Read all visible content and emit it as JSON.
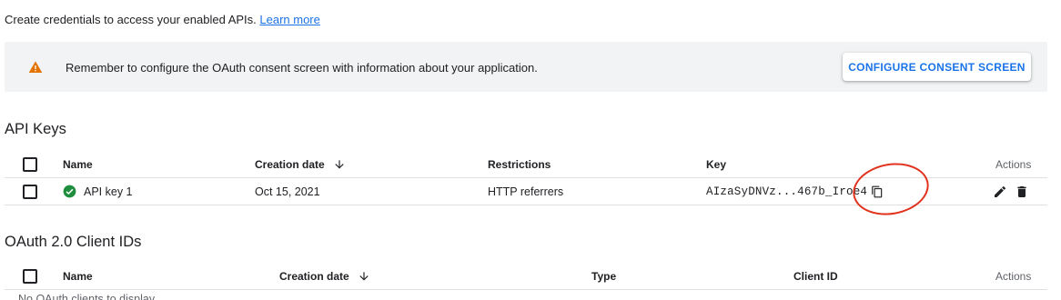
{
  "intro": {
    "text": "Create credentials to access your enabled APIs.",
    "link": "Learn more"
  },
  "banner": {
    "icon": "warning-icon",
    "message": "Remember to configure the OAuth consent screen with information about your application.",
    "button": "CONFIGURE CONSENT SCREEN"
  },
  "api_keys": {
    "title": "API Keys",
    "columns": {
      "name": "Name",
      "creation_date": "Creation date",
      "restrictions": "Restrictions",
      "key": "Key",
      "actions": "Actions"
    },
    "rows": [
      {
        "name": "API key 1",
        "created": "Oct 15, 2021",
        "restrictions": "HTTP referrers",
        "key": "AIzaSyDNVz...467b_Iroe4"
      }
    ]
  },
  "oauth": {
    "title": "OAuth 2.0 Client IDs",
    "columns": {
      "name": "Name",
      "creation_date": "Creation date",
      "type": "Type",
      "client_id": "Client ID",
      "actions": "Actions"
    },
    "empty_text": "No OAuth clients to display"
  },
  "colors": {
    "accent": "#1a73e8",
    "warning": "#e37400",
    "success": "#1e8e3e",
    "annotation": "#e1321d"
  }
}
